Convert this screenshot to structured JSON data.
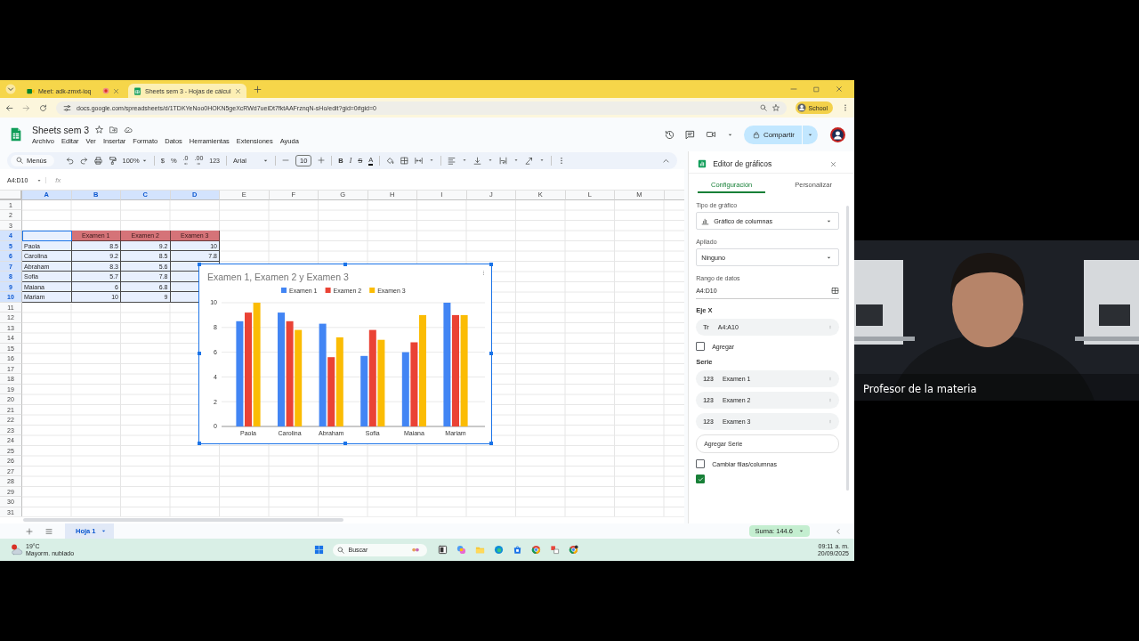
{
  "browser": {
    "tabs": [
      {
        "kind": "call",
        "title": "Meet: adk-zmxt-ioq",
        "selected": false,
        "recording": true
      },
      {
        "kind": "sheet",
        "title": "Sheets sem 3 - Hojas de cálcul",
        "selected": true,
        "recording": false
      }
    ],
    "url": "docs.google.com/spreadsheets/d/1TDKYeNoo0HOKN5geXcRWd7ueiDt7fktAAFrznqN-sHo/edit?gid=0#gid=0",
    "profile": "School"
  },
  "document": {
    "title": "Sheets sem 3",
    "menu": [
      "Archivo",
      "Editar",
      "Ver",
      "Insertar",
      "Formato",
      "Datos",
      "Herramientas",
      "Extensiones",
      "Ayuda"
    ],
    "share_button": "Compartir"
  },
  "toolbar": {
    "search": "Menús",
    "zoom": "100%",
    "currency": "$",
    "percent": "%",
    "decrease_decimals": ".0",
    "increase_decimals": ".00",
    "number_format": "123",
    "font": "Arial",
    "font_size": "10",
    "bold": "B",
    "italic": "I",
    "strikethrough": "S",
    "text_color": "A"
  },
  "formula_bar": {
    "range": "A4:D10",
    "fx": "fx"
  },
  "sheet": {
    "columns": [
      {
        "label": "A",
        "selected": true
      },
      {
        "label": "B",
        "selected": true
      },
      {
        "label": "C",
        "selected": true
      },
      {
        "label": "D",
        "selected": true
      },
      {
        "label": "E",
        "selected": false
      },
      {
        "label": "F",
        "selected": false
      },
      {
        "label": "G",
        "selected": false
      },
      {
        "label": "H",
        "selected": false
      },
      {
        "label": "I",
        "selected": false
      },
      {
        "label": "J",
        "selected": false
      },
      {
        "label": "K",
        "selected": false
      },
      {
        "label": "L",
        "selected": false
      },
      {
        "label": "M",
        "selected": false
      }
    ],
    "rows": [
      {
        "label": "1",
        "selected": false
      },
      {
        "label": "2",
        "selected": false
      },
      {
        "label": "3",
        "selected": false
      },
      {
        "label": "4",
        "selected": true
      },
      {
        "label": "5",
        "selected": true
      },
      {
        "label": "6",
        "selected": true
      },
      {
        "label": "7",
        "selected": true
      },
      {
        "label": "8",
        "selected": true
      },
      {
        "label": "9",
        "selected": true
      },
      {
        "label": "10",
        "selected": true
      },
      {
        "label": "11",
        "selected": false
      },
      {
        "label": "12",
        "selected": false
      },
      {
        "label": "13",
        "selected": false
      },
      {
        "label": "14",
        "selected": false
      },
      {
        "label": "15",
        "selected": false
      },
      {
        "label": "16",
        "selected": false
      },
      {
        "label": "17",
        "selected": false
      },
      {
        "label": "18",
        "selected": false
      },
      {
        "label": "19",
        "selected": false
      },
      {
        "label": "20",
        "selected": false
      },
      {
        "label": "21",
        "selected": false
      },
      {
        "label": "22",
        "selected": false
      },
      {
        "label": "23",
        "selected": false
      },
      {
        "label": "24",
        "selected": false
      },
      {
        "label": "25",
        "selected": false
      },
      {
        "label": "26",
        "selected": false
      },
      {
        "label": "27",
        "selected": false
      },
      {
        "label": "28",
        "selected": false
      },
      {
        "label": "29",
        "selected": false
      },
      {
        "label": "30",
        "selected": false
      },
      {
        "label": "31",
        "selected": false
      }
    ],
    "table": {
      "columns": [
        "Examen 1",
        "Examen 2",
        "Examen 3"
      ],
      "rows": [
        {
          "name": "Paola",
          "scores": [
            "8.5",
            "9.2",
            "10"
          ]
        },
        {
          "name": "Carolina",
          "scores": [
            "9.2",
            "8.5",
            "7.8"
          ]
        },
        {
          "name": "Abraham",
          "scores": [
            "8.3",
            "5.6"
          ]
        },
        {
          "name": "Sofia",
          "scores": [
            "5.7",
            "7.8"
          ]
        },
        {
          "name": "Maiana",
          "scores": [
            "6",
            "6.8"
          ]
        },
        {
          "name": "Mariam",
          "scores": [
            "10",
            "9"
          ]
        }
      ]
    }
  },
  "chart": {
    "chart_data": {
      "type": "bar",
      "title": "Examen 1, Examen 2 y Examen 3",
      "categories": [
        "Paola",
        "Carolina",
        "Abraham",
        "Sofia",
        "Maiana",
        "Mariam"
      ],
      "series": [
        {
          "name": "Examen 1",
          "color": "#4285f4",
          "values": [
            8.5,
            9.2,
            8.3,
            5.7,
            6,
            10
          ]
        },
        {
          "name": "Examen 2",
          "color": "#ea4335",
          "values": [
            9.2,
            8.5,
            5.6,
            7.8,
            6.8,
            9
          ]
        },
        {
          "name": "Examen 3",
          "color": "#fbbc04",
          "values": [
            10,
            7.8,
            7.2,
            7,
            9,
            9
          ]
        }
      ],
      "ylim": [
        0,
        10
      ],
      "yticks": [
        0,
        2,
        4,
        6,
        8,
        10
      ],
      "grid": true,
      "legend": true
    }
  },
  "chart_editor": {
    "title": "Editor de gráficos",
    "tabs": [
      {
        "label": "Configuración",
        "selected": true
      },
      {
        "label": "Personalizar",
        "selected": false
      }
    ],
    "chart_type": {
      "label": "Tipo de gráfico",
      "value": "Gráfico de columnas"
    },
    "stacking": {
      "label": "Apilado",
      "value": "Ninguno"
    },
    "data_range": {
      "label": "Rango de datos",
      "value": "A4:D10"
    },
    "x_axis": {
      "label": "Eje X",
      "chips": [
        {
          "type": "Tr",
          "range": "A4:A10"
        }
      ],
      "add": {
        "label": "Agregar",
        "checked": false
      }
    },
    "series": {
      "label": "Serie",
      "chips": [
        {
          "type": "123",
          "name": "Examen 1"
        },
        {
          "type": "123",
          "name": "Examen 2"
        },
        {
          "type": "123",
          "name": "Examen 3"
        }
      ],
      "add_button": "Agregar Serie"
    },
    "options": [
      {
        "label": "Cambiar filas/columnas",
        "checked": false
      },
      {
        "checked": true
      }
    ]
  },
  "sheet_tabs": [
    {
      "label": "Hoja 1",
      "selected": true
    }
  ],
  "sum": "Suma: 144.6",
  "taskbar": {
    "temperature": "19°C",
    "weather": "Mayorm. nublado",
    "search": "Buscar",
    "time": "09:11 a. m.",
    "date": "20/09/2025"
  },
  "video": {
    "kind": "picture",
    "caption": "Profesor de la materia"
  }
}
